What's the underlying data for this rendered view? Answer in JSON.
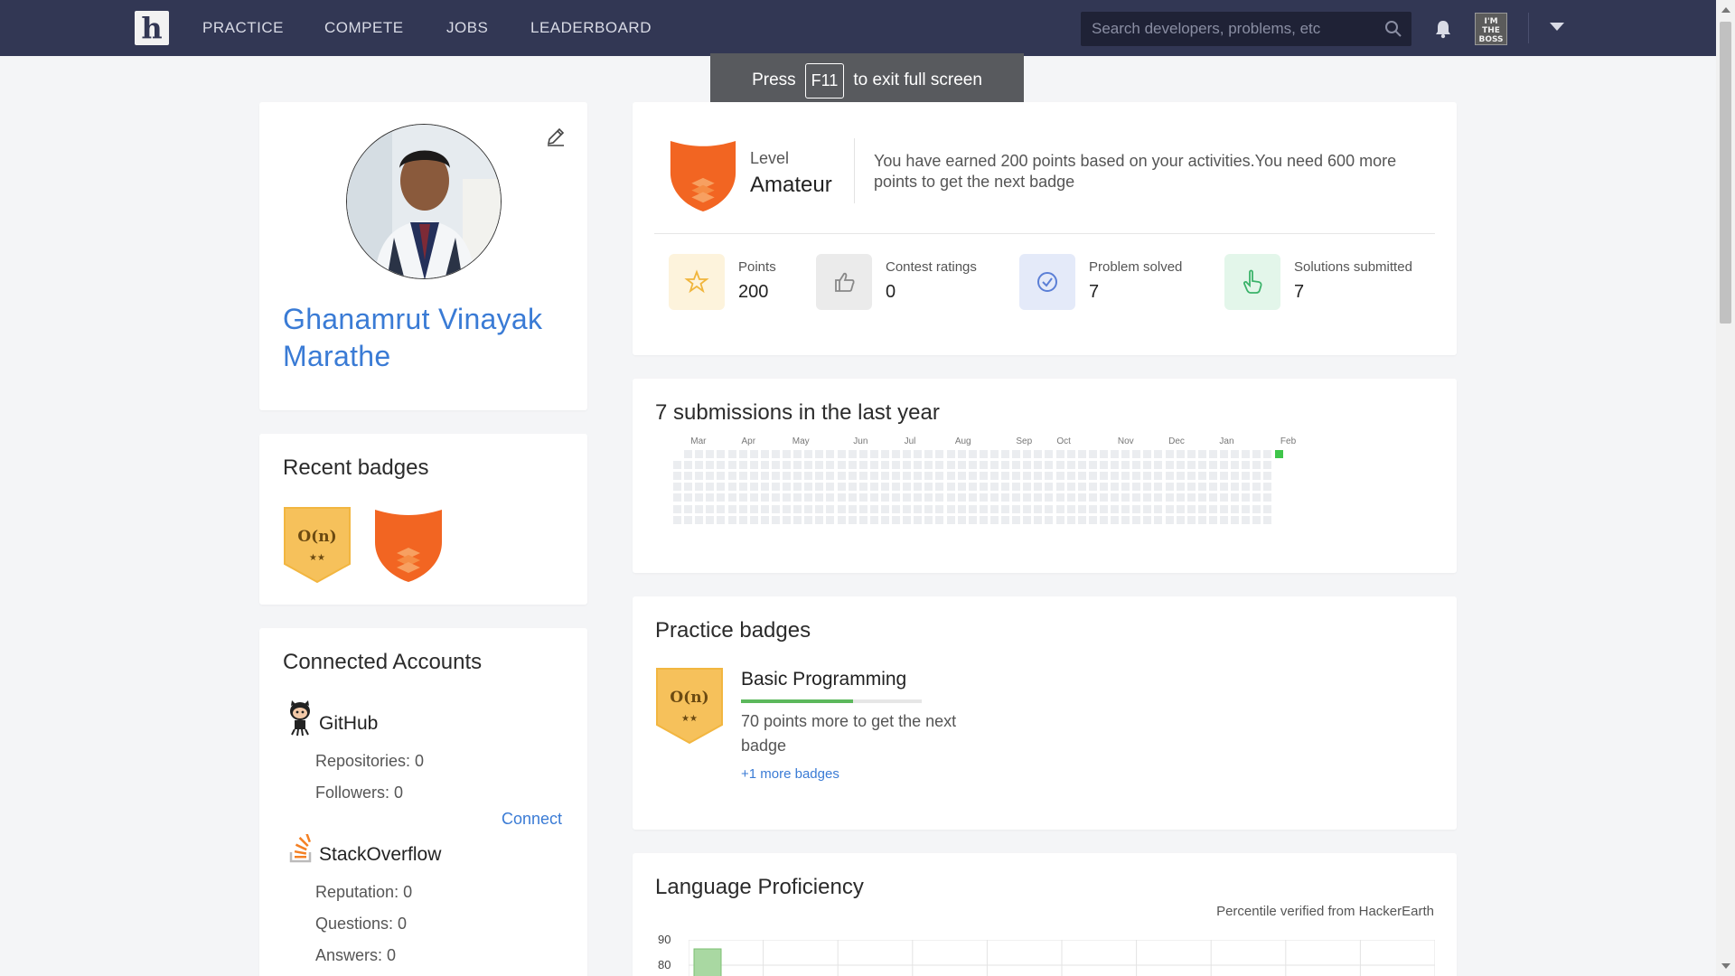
{
  "nav": {
    "logo": "h",
    "links": [
      "PRACTICE",
      "COMPETE",
      "JOBS",
      "LEADERBOARD"
    ],
    "search_placeholder": "Search developers, problems, etc",
    "avatar_text": "I'M THE BOSS"
  },
  "toast": {
    "before": "Press",
    "key": "F11",
    "after": "to exit full screen"
  },
  "profile": {
    "name": "Ghanamrut Vinayak Marathe"
  },
  "level": {
    "label": "Level",
    "value": "Amateur",
    "message": "You have earned 200 points based on your activities.You need 600 more points to get the next badge"
  },
  "stats": [
    {
      "label": "Points",
      "value": "200",
      "icon": "star-icon",
      "bg": "#fdf3dc",
      "color": "#f0b53c"
    },
    {
      "label": "Contest ratings",
      "value": "0",
      "icon": "thumbs-up-icon",
      "bg": "#ebebeb",
      "color": "#888888"
    },
    {
      "label": "Problem solved",
      "value": "7",
      "icon": "check-circle-icon",
      "bg": "#e4eaf9",
      "color": "#5b7fd6"
    },
    {
      "label": "Solutions submitted",
      "value": "7",
      "icon": "pointer-hand-icon",
      "bg": "#e3f6ea",
      "color": "#3bb36a"
    }
  ],
  "submissions": {
    "title": "7 submissions in the last year",
    "months": [
      "Mar",
      "Apr",
      "May",
      "Jun",
      "Jul",
      "Aug",
      "Sep",
      "Oct",
      "Nov",
      "Dec",
      "Jan",
      "Feb"
    ],
    "empty_color": "#ebedf0",
    "active_color": "#3fc54a"
  },
  "recent_badges": {
    "title": "Recent badges",
    "badge_text": "O(n)",
    "badge_stars": "★★",
    "gold": "#f6c15b",
    "orange": "#f26522"
  },
  "practice_badges": {
    "title": "Practice badges",
    "name": "Basic Programming",
    "progress_percent": 62,
    "message": "70 points more to get the next badge",
    "more_link": "+1 more badges"
  },
  "accounts": {
    "title": "Connected Accounts",
    "github": {
      "name": "GitHub",
      "repos": "Repositories: 0",
      "followers": "Followers: 0",
      "connect": "Connect"
    },
    "stackoverflow": {
      "name": "StackOverflow",
      "reputation": "Reputation: 0",
      "questions": "Questions: 0",
      "answers": "Answers: 0"
    }
  },
  "language": {
    "title": "Language Proficiency",
    "note": "Percentile verified from HackerEarth",
    "y_ticks": [
      "90",
      "80"
    ]
  },
  "chart_data": {
    "type": "bar",
    "title": "Language Proficiency",
    "y_ticks": [
      90,
      80
    ],
    "bars": [
      {
        "color": "#a9d8a2"
      }
    ]
  }
}
